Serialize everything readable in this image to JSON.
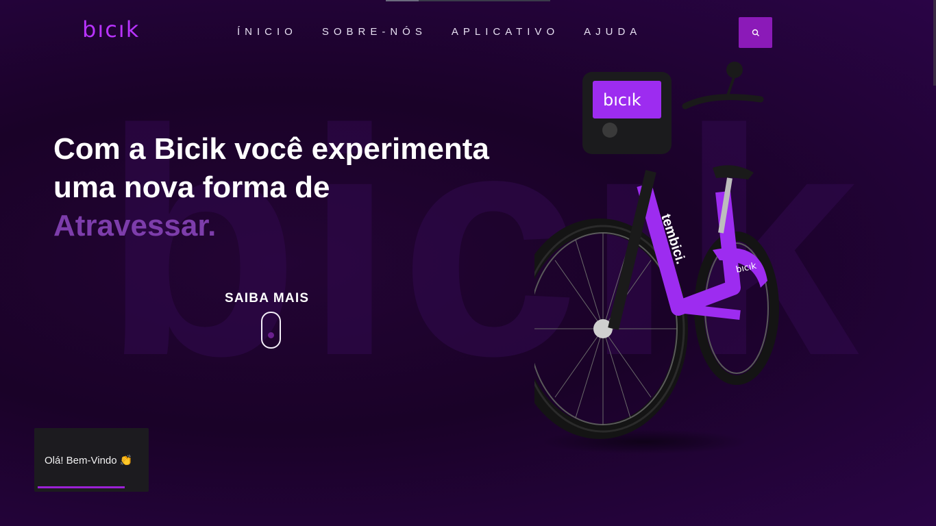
{
  "brand": {
    "logo_text": "bıcık",
    "accent": "#b833ff"
  },
  "nav": {
    "items": [
      {
        "label": "ÍNICIO"
      },
      {
        "label": "SOBRE-NÓS"
      },
      {
        "label": "APLICATIVO"
      },
      {
        "label": "AJUDA"
      }
    ],
    "search_icon": "search-icon"
  },
  "watermark": "bicik",
  "hero": {
    "title_line1": "Com a Bicik você experimenta",
    "title_line2": "uma nova forma de",
    "title_accent": "Atravessar.",
    "cta_label": "SAIBA MAIS",
    "scroll_icon": "scroll-mouse-icon"
  },
  "bike": {
    "basket_brand": "bıcık",
    "frame_brand": "tembici.",
    "fender_brand": "bıcık"
  },
  "toast": {
    "message": "Olá! Bem-Vindo 👏"
  },
  "colors": {
    "background": "#1a0228",
    "purple": "#8b1ab8",
    "accent_text": "#7d3dab"
  }
}
